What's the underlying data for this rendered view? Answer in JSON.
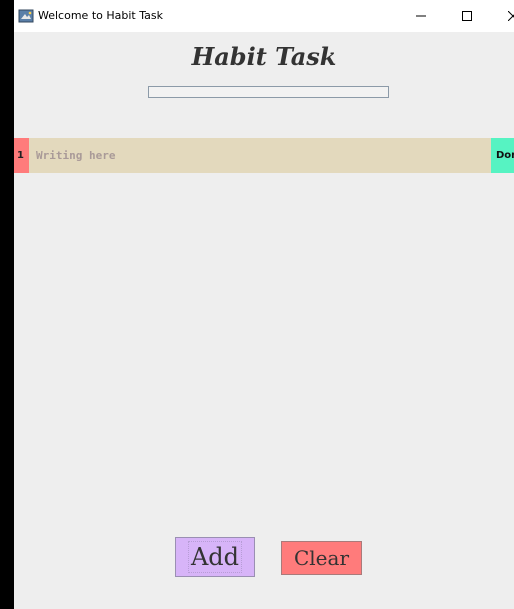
{
  "window": {
    "title": "Welcome to Habit Task",
    "controls": [
      "minimize",
      "maximize",
      "close"
    ]
  },
  "heading": "Habit Task",
  "progress": {
    "value": 0
  },
  "tasks": [
    {
      "number": "1",
      "placeholder": "Writing here",
      "value": "",
      "done_label": "Done"
    }
  ],
  "buttons": {
    "add_label": "Add",
    "clear_label": "Clear"
  },
  "colors": {
    "background": "#eeeeee",
    "task_row": "#e3d9bd",
    "task_number": "#ff7b7b",
    "done": "#56f3c2",
    "add": "#d7b4f8",
    "clear": "#ff7b7b"
  },
  "icons": {
    "app": "java-app-icon",
    "minimize": "minimize-icon",
    "maximize": "maximize-icon",
    "close": "close-icon"
  }
}
